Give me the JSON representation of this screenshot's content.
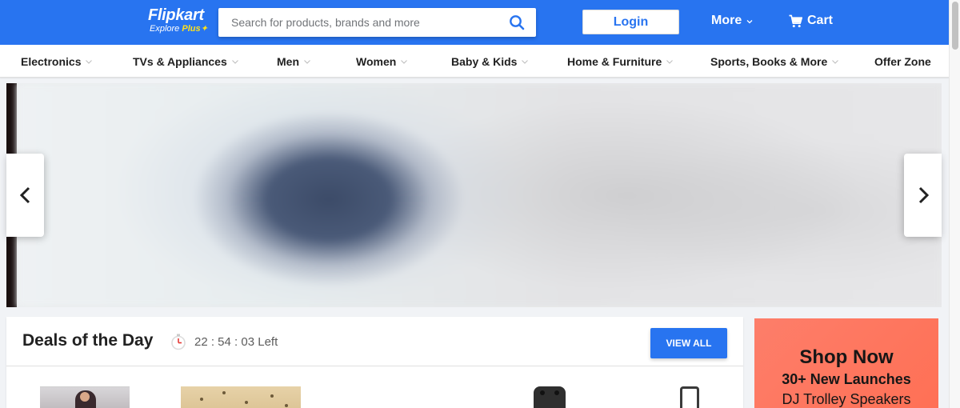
{
  "header": {
    "logo_text": "Flipkart",
    "logo_tagline": "Explore",
    "logo_plus": "Plus",
    "search_placeholder": "Search for products, brands and more",
    "login_label": "Login",
    "more_label": "More",
    "cart_label": "Cart",
    "brand_color": "#2874f0",
    "plus_color": "#ffe11b"
  },
  "categories": [
    {
      "label": "Electronics",
      "has_dropdown": true
    },
    {
      "label": "TVs & Appliances",
      "has_dropdown": true
    },
    {
      "label": "Men",
      "has_dropdown": true
    },
    {
      "label": "Women",
      "has_dropdown": true
    },
    {
      "label": "Baby & Kids",
      "has_dropdown": true
    },
    {
      "label": "Home & Furniture",
      "has_dropdown": true
    },
    {
      "label": "Sports, Books & More",
      "has_dropdown": true
    },
    {
      "label": "Offer Zone",
      "has_dropdown": false
    }
  ],
  "banner": {
    "prev_icon": "chevron-left-icon",
    "next_icon": "chevron-right-icon"
  },
  "deals": {
    "title": "Deals of the Day",
    "timer": "22 : 54 : 03 Left",
    "view_all_label": "VIEW ALL",
    "timer_icon": "stopwatch-icon"
  },
  "ad": {
    "title": "Shop Now",
    "line1": "30+ New Launches",
    "line2": "DJ Trolley Speakers",
    "background_color": "#ff7a62"
  }
}
